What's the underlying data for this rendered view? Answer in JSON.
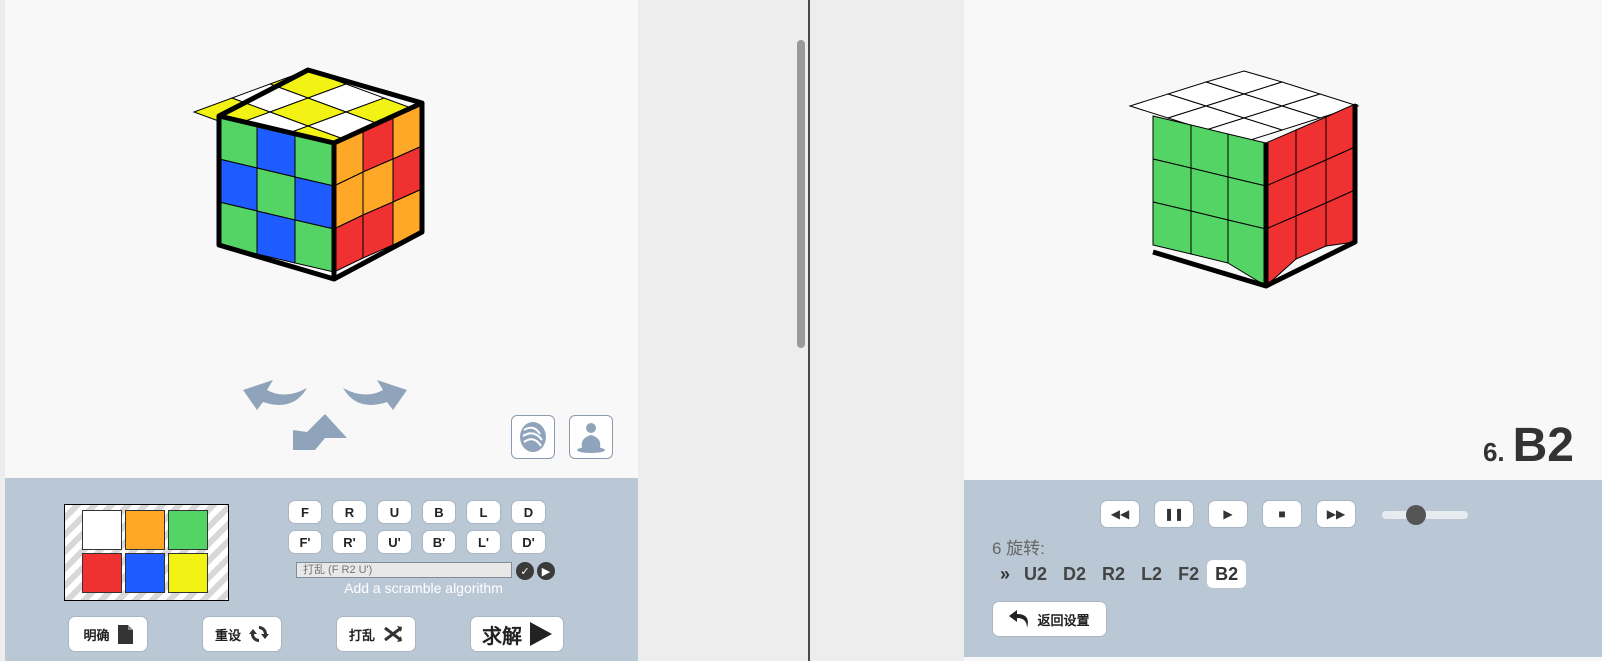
{
  "left": {
    "palette_colors": [
      "#ffffff",
      "#ffa726",
      "#55d466",
      "#ef3131",
      "#1f5cff",
      "#f2f214"
    ],
    "moves_row1": [
      "F",
      "R",
      "U",
      "B",
      "L",
      "D"
    ],
    "moves_row2": [
      "F'",
      "R'",
      "U'",
      "B'",
      "L'",
      "D'"
    ],
    "scramble_placeholder": "打乱 (F R2 U')",
    "scramble_hint": "Add a scramble algorithm",
    "actions": {
      "clear": "明确",
      "reset": "重设",
      "scramble": "打乱",
      "solve": "求解"
    },
    "icons": [
      "rotate-left-arrow-icon",
      "rotate-right-arrow-icon",
      "rotate-up-arrow-icon",
      "hand-icon",
      "person-meditate-icon"
    ]
  },
  "right": {
    "move_number": "6.",
    "current_move": "B2",
    "rotation_count": "6 旋转:",
    "sequence_marker": "»",
    "sequence": [
      "U2",
      "D2",
      "R2",
      "L2",
      "F2",
      "B2"
    ],
    "active_index": 5,
    "back_label": "返回设置",
    "speed_level": 0.4,
    "playback_icons": [
      "rewind-icon",
      "pause-icon",
      "play-icon",
      "stop-icon",
      "fast-forward-icon"
    ]
  },
  "colors": {
    "panel_bg": "#f8f8f8",
    "controls_bg": "#bac8d5",
    "accent_icon": "#8fa4bb"
  }
}
